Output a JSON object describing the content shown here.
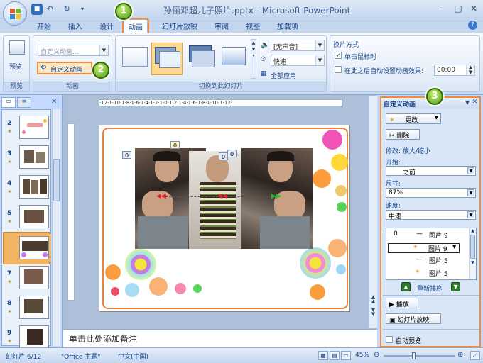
{
  "window": {
    "title": "孙俪邓超儿子照片.pptx - Microsoft PowerPoint",
    "qat_undo_label": "↶",
    "qat_redo_label": "↻",
    "qat_more": "▾"
  },
  "tabs": [
    {
      "label": "开始"
    },
    {
      "label": "插入"
    },
    {
      "label": "设计"
    },
    {
      "label": "动画",
      "active": true
    },
    {
      "label": "幻灯片放映"
    },
    {
      "label": "审阅"
    },
    {
      "label": "视图"
    },
    {
      "label": "加载项"
    }
  ],
  "ribbon": {
    "preview_label": "预览",
    "preview_group": "预览",
    "anim_combo_value": "自定义动画...",
    "custom_anim_button": "自定义动画",
    "anim_group": "动画",
    "sound_value": "[无声音]",
    "speed_value": "快速",
    "apply_all": "全部应用",
    "transition_group": "切换到此幻灯片",
    "advance_title": "换片方式",
    "on_click_label": "单击鼠标时",
    "on_click_checked": true,
    "auto_after_label": "在此之后自动设置动画效果:",
    "auto_after_checked": false,
    "auto_after_value": "00:00"
  },
  "callouts": [
    "1",
    "2",
    "3"
  ],
  "slides": {
    "tab_close": "✕",
    "items": [
      {
        "num": "2"
      },
      {
        "num": "3"
      },
      {
        "num": "4"
      },
      {
        "num": "5"
      },
      {
        "num": "6",
        "selected": true
      },
      {
        "num": "7"
      },
      {
        "num": "8"
      },
      {
        "num": "9"
      }
    ]
  },
  "editor": {
    "ruler_h": "·12·1·10·1·8·1·6·1·4·1·2·1·0·1·2·1·4·1·6·1·8·1·10·1·12·",
    "anim_tags": [
      "0",
      "0",
      "0",
      "0"
    ],
    "notes_placeholder": "单击此处添加备注"
  },
  "task_pane": {
    "title": "自定义动画",
    "change_button": "更改",
    "delete_button": "删除",
    "modify_label": "修改: 放大/缩小",
    "start_label": "开始:",
    "start_value": "之前",
    "size_label": "尺寸:",
    "size_value": "87%",
    "speed_label": "速度:",
    "speed_value": "中速",
    "anim_list": [
      {
        "order": "0",
        "name": "图片 9"
      },
      {
        "order": "",
        "name": "图片 9",
        "selected": true
      },
      {
        "order": "",
        "name": "图片 5"
      },
      {
        "order": "",
        "name": "图片 5"
      }
    ],
    "reorder_label": "重新排序",
    "play_button": "播放",
    "slideshow_button": "幻灯片放映",
    "autopreview_label": "自动预览",
    "autopreview_checked": false
  },
  "statusbar": {
    "slide_info": "幻灯片 6/12",
    "theme": "\"Office 主题\"",
    "language": "中文(中国)",
    "zoom": "45%",
    "zoom_minus": "⊖",
    "zoom_plus": "⊕"
  },
  "colors": {
    "highlight_orange": "#f08c3c",
    "callout_green": "#4f9b1c",
    "ribbon_blue": "#c4d6ee"
  }
}
